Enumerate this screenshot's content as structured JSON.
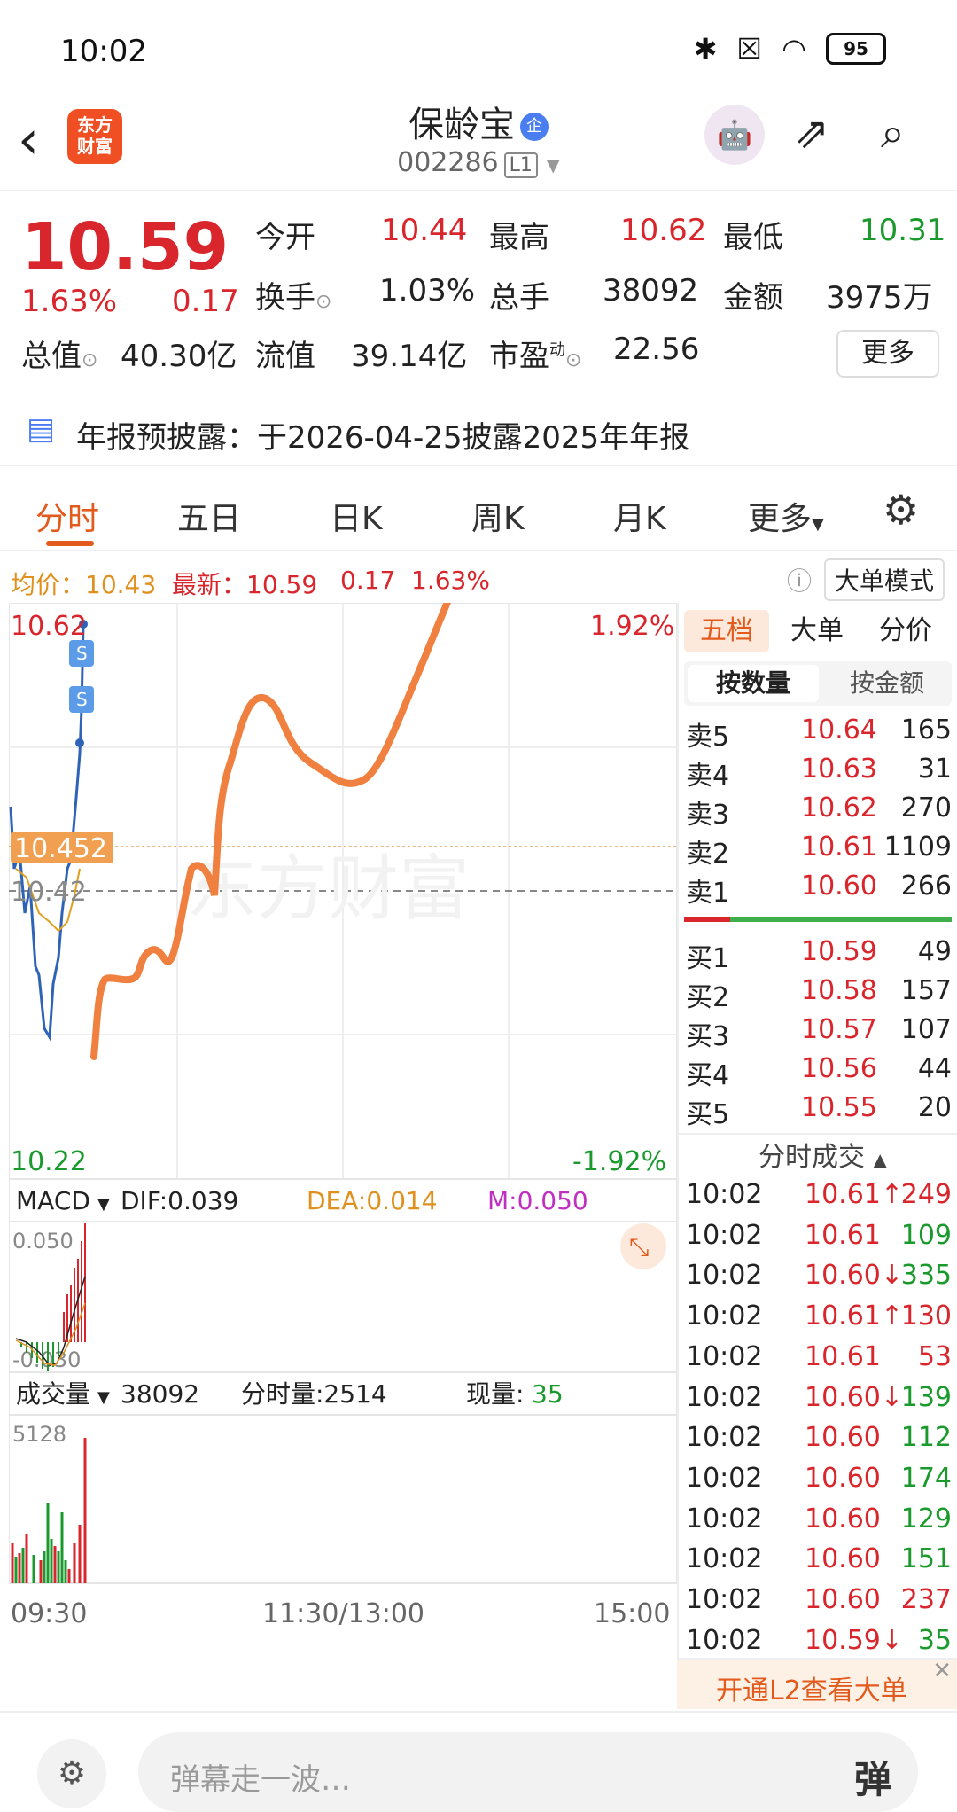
{
  "status": {
    "time": "10:02",
    "battery": "95"
  },
  "header": {
    "logo": "东方\n财富",
    "name": "保龄宝",
    "code": "002286",
    "level": "L1"
  },
  "quote": {
    "price": "10.59",
    "change_pct": "1.63%",
    "change": "0.17",
    "open_label": "今开",
    "open": "10.44",
    "high_label": "最高",
    "high": "10.62",
    "low_label": "最低",
    "low": "10.31",
    "turnover_label": "换手",
    "turnover": "1.03%",
    "volume_label": "总手",
    "volume": "38092",
    "amount_label": "金额",
    "amount": "3975万",
    "mktcap_label": "总值",
    "mktcap": "40.30亿",
    "float_label": "流值",
    "float": "39.14亿",
    "pe_label": "市盈",
    "pe_sup": "动",
    "pe": "22.56",
    "more": "更多"
  },
  "notice": "年报预披露：于2026-04-25披露2025年年报",
  "tabs": [
    "分时",
    "五日",
    "日K",
    "周K",
    "月K",
    "更多"
  ],
  "infobar": {
    "avg": "均价：10.43",
    "latest": "最新：10.59",
    "chg": "0.17",
    "pct": "1.63%",
    "mode": "大单模式"
  },
  "chart_labels": {
    "top_price": "10.62",
    "top_pct": "1.92%",
    "bottom_price": "10.22",
    "bottom_pct": "-1.92%",
    "avg_tag": "10.452",
    "prev": "10.42",
    "watermark": "东方财富",
    "macd": "MACD",
    "dif": "DIF:0.039",
    "dea": "DEA:0.014",
    "m": "M:0.050",
    "macd_top": "0.050",
    "macd_bottom": "-0.030",
    "vol": "成交量",
    "vol_total": "38092",
    "vol_min": "分时量:2514",
    "vol_now_label": "现量:",
    "vol_now": "35",
    "vol_top": "5128",
    "t_start": "09:30",
    "t_mid": "11:30/13:00",
    "t_end": "15:00"
  },
  "orderbook": {
    "tabs": [
      "五档",
      "大单",
      "分价"
    ],
    "subtabs": [
      "按数量",
      "按金额"
    ],
    "asks": [
      {
        "label": "卖5",
        "price": "10.64",
        "vol": "165"
      },
      {
        "label": "卖4",
        "price": "10.63",
        "vol": "31"
      },
      {
        "label": "卖3",
        "price": "10.62",
        "vol": "270"
      },
      {
        "label": "卖2",
        "price": "10.61",
        "vol": "1109"
      },
      {
        "label": "卖1",
        "price": "10.60",
        "vol": "266"
      }
    ],
    "bids": [
      {
        "label": "买1",
        "price": "10.59",
        "vol": "49"
      },
      {
        "label": "买2",
        "price": "10.58",
        "vol": "157"
      },
      {
        "label": "买3",
        "price": "10.57",
        "vol": "107"
      },
      {
        "label": "买4",
        "price": "10.56",
        "vol": "44"
      },
      {
        "label": "买5",
        "price": "10.55",
        "vol": "20"
      }
    ],
    "ticks_title": "分时成交",
    "ticks": [
      {
        "t": "10:02",
        "p": "10.61↑",
        "v": "249",
        "c": "red"
      },
      {
        "t": "10:02",
        "p": "10.61",
        "v": "109",
        "c": "green"
      },
      {
        "t": "10:02",
        "p": "10.60↓",
        "v": "335",
        "c": "green"
      },
      {
        "t": "10:02",
        "p": "10.61↑",
        "v": "130",
        "c": "red"
      },
      {
        "t": "10:02",
        "p": "10.61",
        "v": "53",
        "c": "red"
      },
      {
        "t": "10:02",
        "p": "10.60↓",
        "v": "139",
        "c": "green"
      },
      {
        "t": "10:02",
        "p": "10.60",
        "v": "112",
        "c": "green"
      },
      {
        "t": "10:02",
        "p": "10.60",
        "v": "174",
        "c": "green"
      },
      {
        "t": "10:02",
        "p": "10.60",
        "v": "129",
        "c": "green"
      },
      {
        "t": "10:02",
        "p": "10.60",
        "v": "151",
        "c": "green"
      },
      {
        "t": "10:02",
        "p": "10.60",
        "v": "237",
        "c": "red"
      },
      {
        "t": "10:02",
        "p": "10.59↓",
        "v": "35",
        "c": "green"
      }
    ],
    "promo": "开通L2查看大单"
  },
  "bottom": {
    "placeholder": "弹幕走一波…",
    "danmu": "弹"
  }
}
